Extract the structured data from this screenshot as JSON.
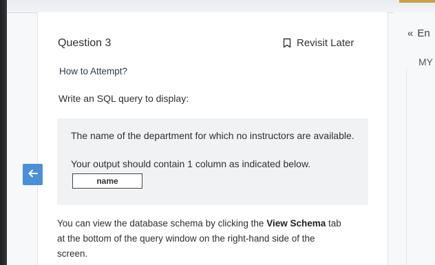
{
  "question": {
    "title": "Question 3",
    "revisit_label": "Revisit Later",
    "how_to": "How to Attempt?",
    "intro": "Write an SQL query to display:",
    "task_line1": "The name of the department for which no instructors are available.",
    "task_line2": "Your output should contain 1 column as indicated below.",
    "column_header": "name",
    "schema_note_part1": "You can view the database schema by clicking the",
    "schema_note_bold": "View Schema",
    "schema_note_part2": "tab",
    "schema_note_line2": "at the bottom of the query window on the right-hand side of the",
    "schema_note_line3": "screen."
  },
  "side": {
    "expand_icon": "«",
    "expand_label": "En",
    "my_label": "MY"
  },
  "icons": {
    "back": "arrow-left-icon",
    "bookmark": "bookmark-icon",
    "expand": "double-chevron-left-icon"
  },
  "colors": {
    "back_button": "#4b8fd6",
    "task_box": "#f1f2f4"
  }
}
